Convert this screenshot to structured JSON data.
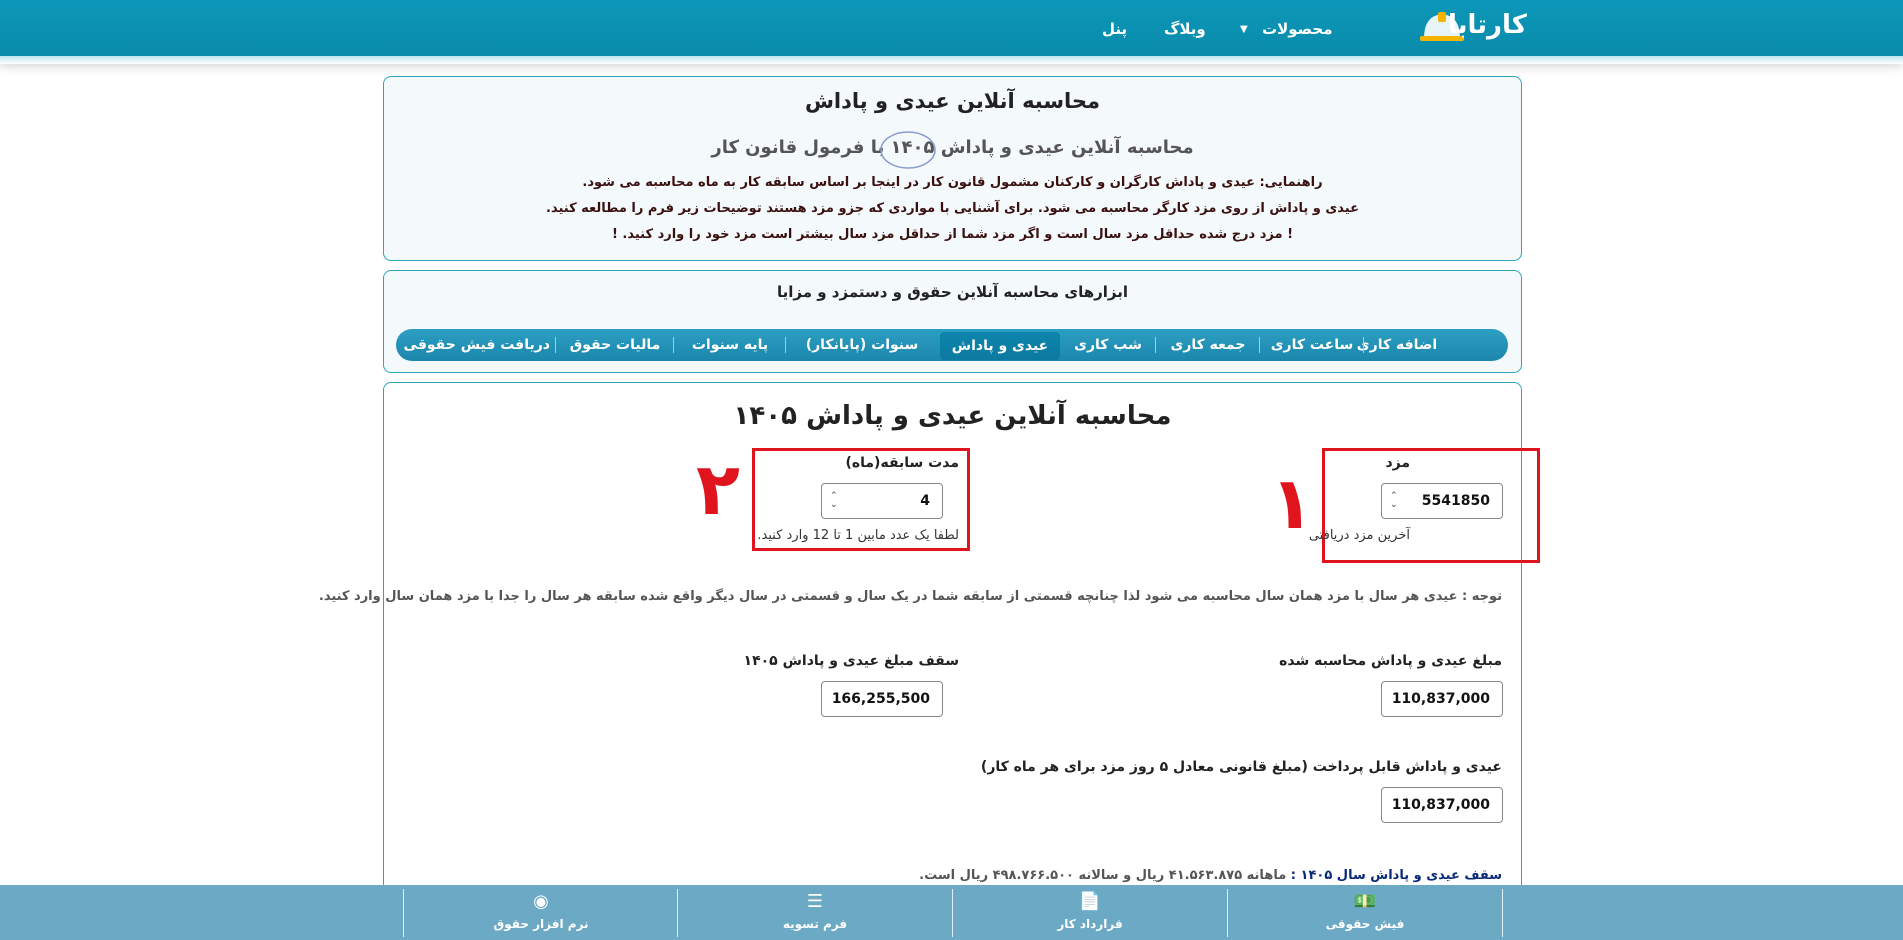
{
  "header": {
    "logo_text": "کارتابا",
    "nav": {
      "products": "محصولات",
      "blog": "وبلاگ",
      "panel": "پنل"
    }
  },
  "intro": {
    "title": "محاسبه آنلاین عیدی و پاداش",
    "subtitle": "محاسبه آنلاین عیدی و پاداش ۱۴۰۵ با فرمول قانون کار",
    "guide_lines": [
      "راهنمایی: عیدی و پاداش کارگران و کارکنان مشمول قانون کار در اینجا بر اساس سابقه کار به ماه محاسبه می شود.",
      "عیدی و پاداش از روی مزد کارگر محاسبه می شود. برای آشنایی با مواردی که جزو مزد هستند توضیحات زیر فرم را مطالعه کنید.",
      "! مزد درج شده حداقل مزد سال است و اگر مزد شما از حداقل مزد سال بیشتر است مزد خود را وارد کنید. !"
    ]
  },
  "tools": {
    "title": "ابزارهای محاسبه آنلاین حقوق و دستمزد و مزایا",
    "tabs": [
      {
        "label": "اضافه کاری",
        "active": false
      },
      {
        "label": "ساعت کاری",
        "active": false
      },
      {
        "label": "جمعه کاری",
        "active": false
      },
      {
        "label": "شب کاری",
        "active": false
      },
      {
        "label": "عیدی و پاداش",
        "active": true
      },
      {
        "label": "سنوات (پایانکار)",
        "active": false
      },
      {
        "label": "پایه سنوات",
        "active": false
      },
      {
        "label": "مالیات حقوق",
        "active": false
      },
      {
        "label": "دریافت فیش حقوقی",
        "active": false
      }
    ]
  },
  "form": {
    "title": "محاسبه آنلاین عیدی و پاداش ۱۴۰۵",
    "wage": {
      "label": "مزد",
      "value": "5541850",
      "hint": "آخرین مزد دریافتی",
      "marker": "۱"
    },
    "service": {
      "label": "مدت سابقه(ماه)",
      "value": "4",
      "hint": "لطفا یک عدد مابین 1 تا 12 وارد کنید.",
      "marker": "۲"
    },
    "note": "توجه : عیدی هر سال با مزد همان سال محاسبه می شود لذا چنانچه قسمتی از سابقه شما در یک سال و قسمتی در سال دیگر واقع شده سابقه هر سال را جدا با مزد همان سال وارد کنید.",
    "calculated": {
      "label": "مبلغ عیدی و پاداش محاسبه شده",
      "value": "110,837,000"
    },
    "cap": {
      "label": "سقف مبلغ عیدی و پاداش ۱۴۰۵",
      "value": "166,255,500"
    },
    "payable": {
      "label": "عیدی و پاداش قابل پرداخت (مبلغ قانونی معادل ۵ روز مزد برای هر ماه کار)",
      "value": "110,837,000"
    },
    "ceiling_line": {
      "prefix": "سقف عیدی و پاداش سال ۱۴۰۵ :",
      "rest": "ماهانه ۴۱.۵۶۳.۸۷۵ ریال و سالانه ۴۹۸.۷۶۶.۵۰۰ ریال است."
    }
  },
  "footer": {
    "items": [
      {
        "label": "فیش حقوقی",
        "icon": "💵"
      },
      {
        "label": "قرارداد کار",
        "icon": "📄"
      },
      {
        "label": "فرم تسویه",
        "icon": "☰"
      },
      {
        "label": "نرم افزار حقوق",
        "icon": "◉"
      }
    ]
  }
}
